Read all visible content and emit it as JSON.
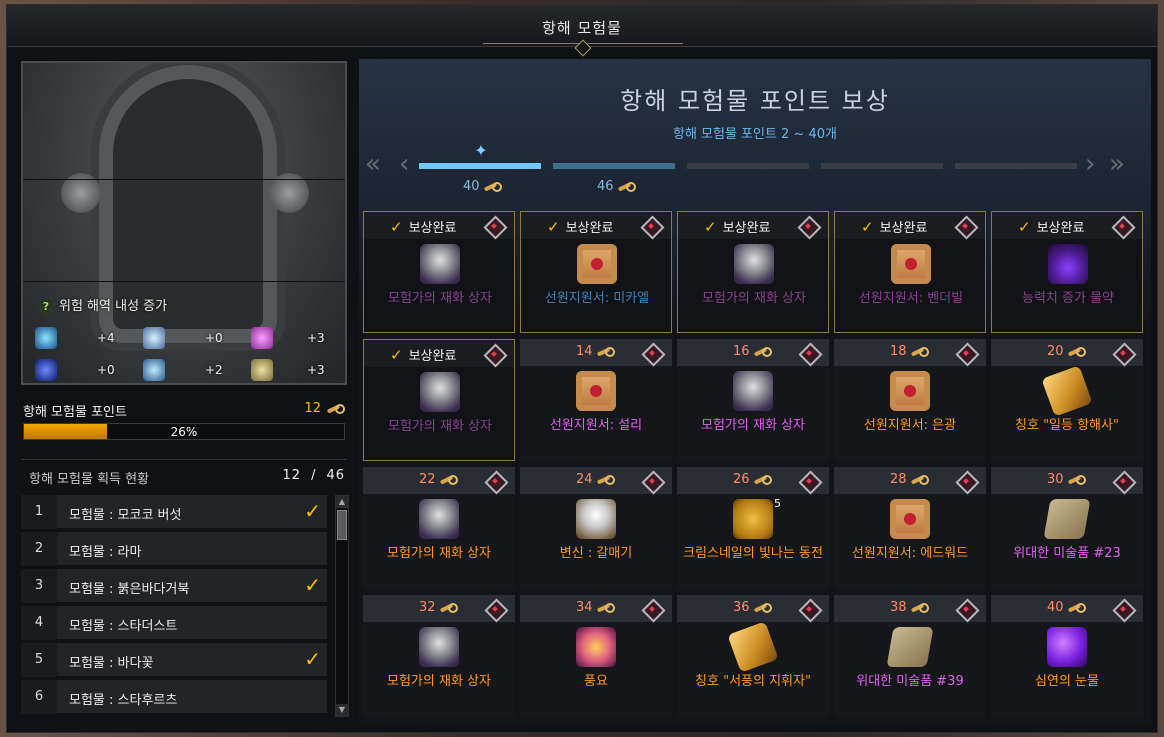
{
  "window": {
    "title": "항해 모험물"
  },
  "left": {
    "buff_title": "위험 해역 내성 증가",
    "stats": [
      {
        "icon": "wave-resist-icon",
        "value": "+4"
      },
      {
        "icon": "wind-resist-icon",
        "value": "+0"
      },
      {
        "icon": "magic-resist-icon",
        "value": "+3"
      },
      {
        "icon": "storm-resist-icon",
        "value": "+0"
      },
      {
        "icon": "lightning-resist-icon",
        "value": "+2"
      },
      {
        "icon": "whirlpool-resist-icon",
        "value": "+3"
      }
    ],
    "points_label": "항해 모험물 포인트",
    "points_value": "12",
    "progress_percent": 26,
    "progress_text": "26%",
    "acquisition_label": "항해 모험물 획득 현황",
    "acquired": "12",
    "total": "46",
    "separator": "/",
    "list": [
      {
        "index": "1",
        "name": "모험물 : 모코코 버섯",
        "checked": true
      },
      {
        "index": "2",
        "name": "모험물 : 라마",
        "checked": false
      },
      {
        "index": "3",
        "name": "모험물 : 붉은바다거북",
        "checked": true
      },
      {
        "index": "4",
        "name": "모험물 : 스타더스트",
        "checked": false
      },
      {
        "index": "5",
        "name": "모험물 : 바다꽃",
        "checked": true
      },
      {
        "index": "6",
        "name": "모험물 : 스타후르츠",
        "checked": false
      }
    ]
  },
  "right": {
    "heading": "항해 모험물 포인트 보상",
    "subheading": "항해 모험물 포인트 2 ~ 40개",
    "tiers": [
      {
        "label": "40"
      },
      {
        "label": "46"
      }
    ],
    "claimed_label": "보상완료",
    "rewards": [
      {
        "claimed": true,
        "points": "",
        "name": "모험가의 재화 상자",
        "color": "gray",
        "icon": "chest-icon"
      },
      {
        "claimed": true,
        "points": "",
        "name": "선원지원서: 미카엘",
        "color": "blue",
        "icon": "scroll-icon"
      },
      {
        "claimed": true,
        "points": "",
        "name": "모험가의 재화 상자",
        "color": "gray",
        "icon": "chest-icon"
      },
      {
        "claimed": true,
        "points": "",
        "name": "선원지원서: 벤더빌",
        "color": "gray",
        "icon": "scroll-icon"
      },
      {
        "claimed": true,
        "points": "",
        "name": "능력치 증가 물약",
        "color": "gray",
        "icon": "potion-icon"
      },
      {
        "claimed": true,
        "points": "",
        "name": "모험가의 재화 상자",
        "color": "gray",
        "icon": "chest-icon"
      },
      {
        "claimed": false,
        "points": "14",
        "name": "선원지원서: 설리",
        "color": "purple",
        "icon": "scroll-icon"
      },
      {
        "claimed": false,
        "points": "16",
        "name": "모험가의 재화 상자",
        "color": "purple",
        "icon": "chest-icon"
      },
      {
        "claimed": false,
        "points": "18",
        "name": "선원지원서: 은광",
        "color": "orange",
        "icon": "scroll-icon"
      },
      {
        "claimed": false,
        "points": "20",
        "name": "칭호 \"일등 항해사\"",
        "color": "orange",
        "icon": "title-scroll-icon"
      },
      {
        "claimed": false,
        "points": "22",
        "name": "모험가의 재화 상자",
        "color": "orange",
        "icon": "chest-icon"
      },
      {
        "claimed": false,
        "points": "24",
        "name": "변신 : 갈매기",
        "color": "orange",
        "icon": "seagull-icon"
      },
      {
        "claimed": false,
        "points": "26",
        "name": "크림스네일의 빛나는 동전",
        "color": "orange",
        "icon": "coin-icon",
        "qty": "5"
      },
      {
        "claimed": false,
        "points": "28",
        "name": "선원지원서: 에드워드",
        "color": "orange",
        "icon": "scroll-icon"
      },
      {
        "claimed": false,
        "points": "30",
        "name": "위대한 미술품 #23",
        "color": "purple",
        "icon": "art-icon"
      },
      {
        "claimed": false,
        "points": "32",
        "name": "모험가의 재화 상자",
        "color": "orange",
        "icon": "chest-icon"
      },
      {
        "claimed": false,
        "points": "34",
        "name": "풍요",
        "color": "orange",
        "icon": "star-icon"
      },
      {
        "claimed": false,
        "points": "36",
        "name": "칭호 \"서풍의 지휘자\"",
        "color": "orange",
        "icon": "title-scroll-icon"
      },
      {
        "claimed": false,
        "points": "38",
        "name": "위대한 미술품 #39",
        "color": "purple",
        "icon": "art-icon"
      },
      {
        "claimed": false,
        "points": "40",
        "name": "심연의 눈물",
        "color": "orange",
        "icon": "gem-icon"
      }
    ]
  },
  "colors": {
    "accent_gold": "#f5c000",
    "progress_orange": "#e09000",
    "tier_blue": "#6ec7f5",
    "point_red": "#ff8a66"
  }
}
